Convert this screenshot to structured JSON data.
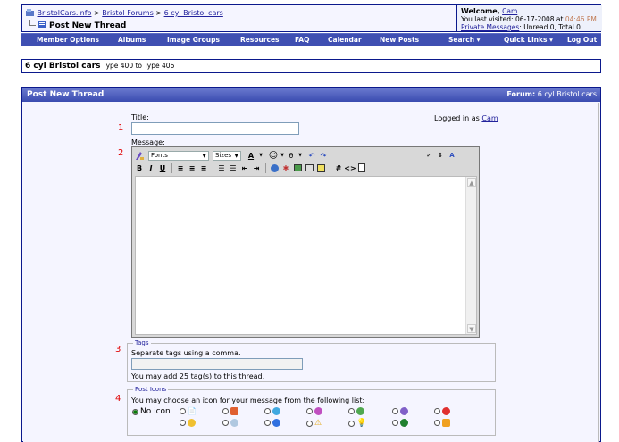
{
  "breadcrumb": {
    "site": "BristolCars.info",
    "sep1": ">",
    "forums": "Bristol Forums",
    "sep2": ">",
    "forum": "6 cyl Bristol cars",
    "page": "Post New Thread"
  },
  "welcome": {
    "greeting": "Welcome,",
    "user": "Cam",
    "period": ".",
    "last_visit_prefix": "You last visited: 06-17-2008 at",
    "last_visit_time": "04:46 PM",
    "pm_link": "Private Messages",
    "pm_suffix": ": Unread 0, Total 0."
  },
  "menu": [
    "Member Options",
    "Albums",
    "Image Groups",
    "Resources",
    "FAQ",
    "Calendar",
    "New Posts",
    "Search ▾",
    "Quick Links ▾",
    "Log Out"
  ],
  "forum_info": {
    "name": "6 cyl Bristol cars",
    "desc": "Type 400 to Type 406"
  },
  "panel": {
    "title": "Post New Thread",
    "forum_label": "Forum:",
    "forum_name": "6 cyl Bristol cars"
  },
  "form": {
    "title_label": "Title:",
    "title_value": "",
    "logged_in_prefix": "Logged in as",
    "logged_in_user": "Cam",
    "message_label": "Message:",
    "fonts_select": "Fonts",
    "sizes_select": "Sizes",
    "tags_legend": "Tags",
    "tags_hint": "Separate tags using a comma.",
    "tags_value": "",
    "tags_limit": "You may add 25 tag(s) to this thread.",
    "icons_legend": "Post Icons",
    "icons_hint": "You may choose an icon for your message from the following list:",
    "no_icon": "No icon"
  },
  "markers": [
    "1",
    "2",
    "3",
    "4"
  ],
  "colors": {
    "menubar": "#3f4fb2",
    "panel_head": "#4a5bbc",
    "marker": "#e00000",
    "link": "#22229c",
    "panel_bg": "#f5f5ff"
  }
}
